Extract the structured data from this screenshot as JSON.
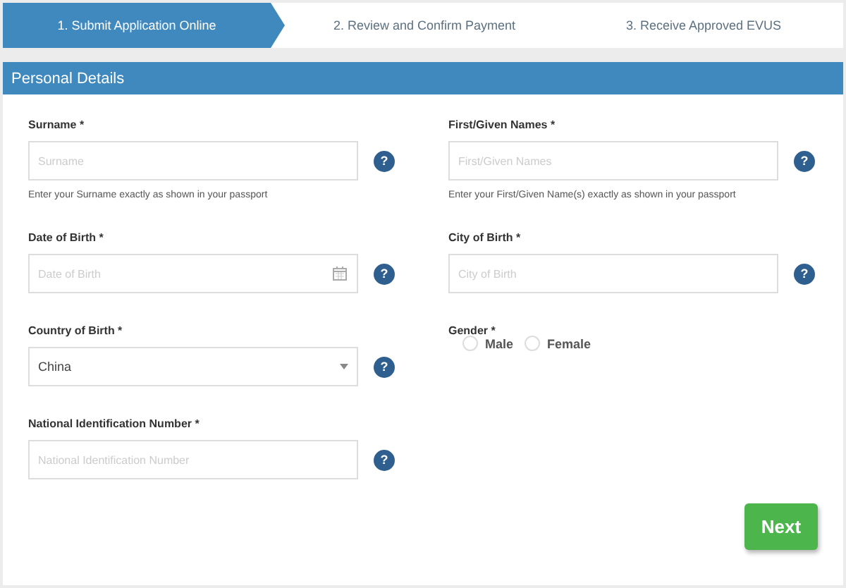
{
  "steps": [
    {
      "label": "1. Submit Application Online",
      "selected": true
    },
    {
      "label": "2. Review and Confirm Payment",
      "selected": false
    },
    {
      "label": "3. Receive Approved EVUS",
      "selected": false
    }
  ],
  "panel": {
    "title": "Personal Details",
    "fields": [
      {
        "kind": "text",
        "label": "Surname *",
        "placeholder": "Surname",
        "hint": "Enter your Surname exactly as shown in your passport",
        "help": "?"
      },
      {
        "kind": "text",
        "label": "First/Given Names *",
        "placeholder": "First/Given Names",
        "hint": "Enter your First/Given Name(s) exactly as shown in your passport",
        "help": "?"
      },
      {
        "kind": "date",
        "label": "Date of Birth *",
        "placeholder": "Date of Birth",
        "help": "?"
      },
      {
        "kind": "text",
        "label": "City of Birth *",
        "placeholder": "City of Birth",
        "help": "?"
      },
      {
        "kind": "select",
        "label": "Country of Birth *",
        "value": "China",
        "help": "?"
      },
      {
        "kind": "radio",
        "label": "Gender *",
        "options": [
          {
            "label": "Male",
            "selected": false
          },
          {
            "label": "Female",
            "selected": false
          }
        ]
      },
      {
        "kind": "text",
        "label": "National Identification Number *",
        "placeholder": "National Identification Number",
        "help": "?"
      }
    ],
    "button": "Next"
  }
}
